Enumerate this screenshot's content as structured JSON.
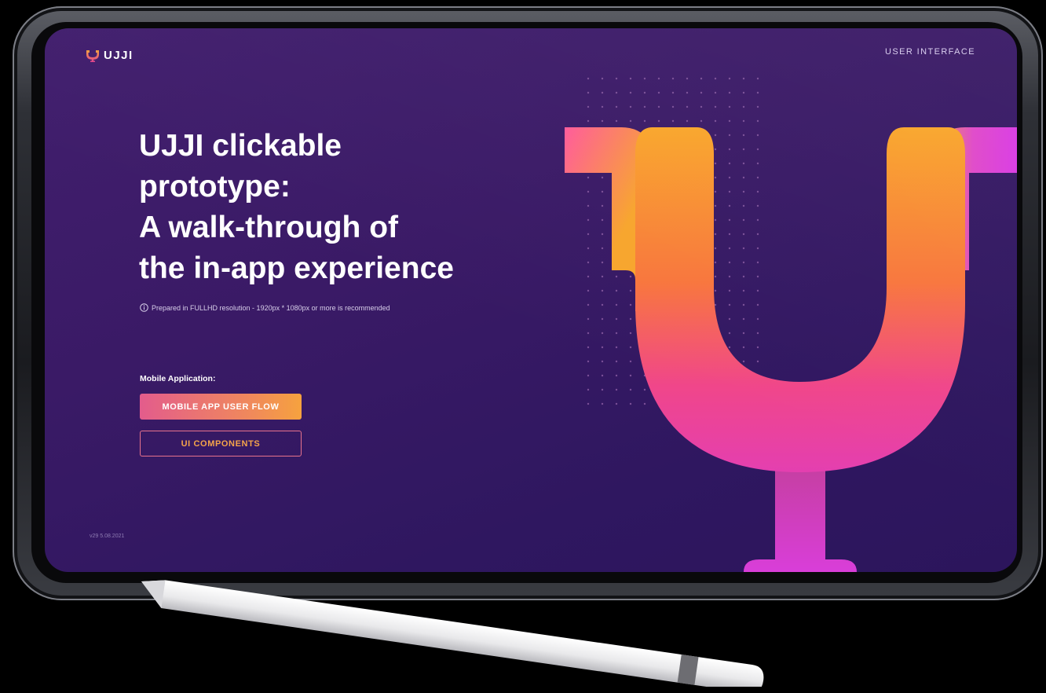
{
  "brand": {
    "name": "UJJI"
  },
  "header": {
    "top_link": "USER INTERFACE"
  },
  "hero": {
    "headline_lines": [
      "UJJI clickable",
      "prototype:",
      "A walk-through of",
      "the in-app experience"
    ],
    "note": "Prepared in FULLHD resolution - 1920px * 1080px or more is recommended"
  },
  "section": {
    "label": "Mobile Application:"
  },
  "buttons": {
    "primary": "MOBILE APP USER FLOW",
    "secondary": "UI COMPONENTS"
  },
  "footer": {
    "version": "v29   5.08.2021"
  },
  "icons": [
    "ujji-logo-icon",
    "info-icon",
    "ujji-graphic"
  ],
  "colors": {
    "screen_bg": "#3a1a66",
    "accent_orange": "#f6a23e",
    "accent_pink": "#e35c8c",
    "accent_magenta": "#d63ae0"
  }
}
